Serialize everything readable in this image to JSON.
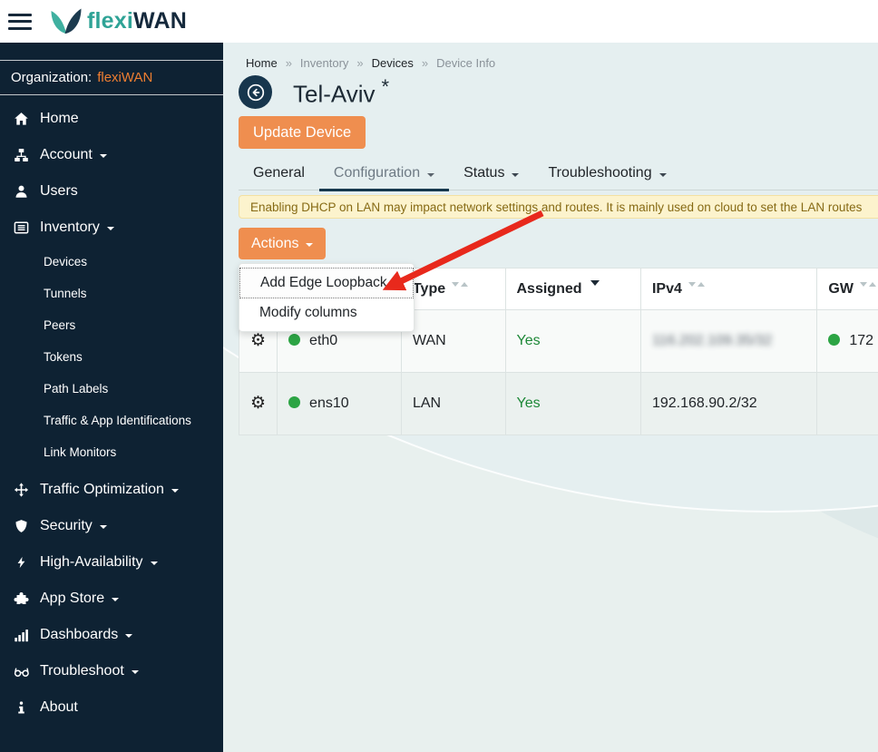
{
  "brand": {
    "flexi": "flexi",
    "wan": "WAN"
  },
  "sidebar": {
    "organization_label": "Organization:",
    "organization_name": "flexiWAN",
    "items": [
      {
        "label": "Home"
      },
      {
        "label": "Account"
      },
      {
        "label": "Users"
      },
      {
        "label": "Inventory"
      },
      {
        "label": "Devices"
      },
      {
        "label": "Tunnels"
      },
      {
        "label": "Peers"
      },
      {
        "label": "Tokens"
      },
      {
        "label": "Path Labels"
      },
      {
        "label": "Traffic & App Identifications"
      },
      {
        "label": "Link Monitors"
      },
      {
        "label": "Traffic Optimization"
      },
      {
        "label": "Security"
      },
      {
        "label": "High-Availability"
      },
      {
        "label": "App Store"
      },
      {
        "label": "Dashboards"
      },
      {
        "label": "Troubleshoot"
      },
      {
        "label": "About"
      }
    ]
  },
  "breadcrumb": {
    "separator": "»",
    "items": [
      "Home",
      "Inventory",
      "Devices",
      "Device Info"
    ]
  },
  "page": {
    "title": "Tel-Aviv",
    "title_suffix": "*"
  },
  "buttons": {
    "update_device": "Update Device",
    "actions": "Actions"
  },
  "tabs": [
    {
      "label": "General"
    },
    {
      "label": "Configuration"
    },
    {
      "label": "Status"
    },
    {
      "label": "Troubleshooting"
    }
  ],
  "alert": {
    "text": "Enabling DHCP on LAN may impact network settings and routes. It is mainly used on cloud to set the LAN routes"
  },
  "menu": {
    "items": [
      "Add Edge Loopback",
      "Modify columns"
    ]
  },
  "icons": {
    "gear": "⚙"
  },
  "table": {
    "headers": {
      "type": "Type",
      "assigned": "Assigned",
      "ipv4": "IPv4",
      "gw": "GW"
    },
    "rows": [
      {
        "name": "eth0",
        "type": "WAN",
        "assigned": "Yes",
        "ipv4": "116.202.109.35/32",
        "gw": "172"
      },
      {
        "name": "ens10",
        "type": "LAN",
        "assigned": "Yes",
        "ipv4": "192.168.90.2/32",
        "gw": ""
      }
    ]
  },
  "colors": {
    "accent_orange": "#ef8e4f",
    "org_orange": "#ee7e31",
    "sidebar_bg": "#0e2233",
    "brand_teal": "#2fa396",
    "brand_navy": "#15293c",
    "status_green": "#2ca444",
    "yes_green": "#1e8838",
    "alert_bg": "#fcf3cd",
    "alert_text": "#866a14",
    "arrow_red": "#e8291c",
    "active_tab_underline": "#16384e"
  }
}
